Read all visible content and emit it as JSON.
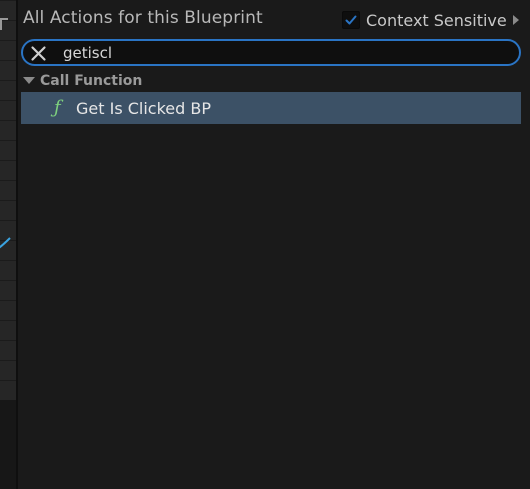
{
  "panel": {
    "title": "All Actions for this Blueprint",
    "context_sensitive": {
      "label": "Context Sensitive",
      "checked": true
    }
  },
  "search": {
    "value": "getiscl",
    "placeholder": ""
  },
  "results": {
    "category": "Call Function",
    "items": [
      {
        "label": "Get Is Clicked BP",
        "icon": "function-icon",
        "selected": true
      }
    ]
  },
  "colors": {
    "search_focus_border": "#2a74c4",
    "selected_row": "#3c5166",
    "function_icon": "#7ed07e",
    "checkmark": "#2a74c4",
    "wire": "#3aa3e0"
  }
}
